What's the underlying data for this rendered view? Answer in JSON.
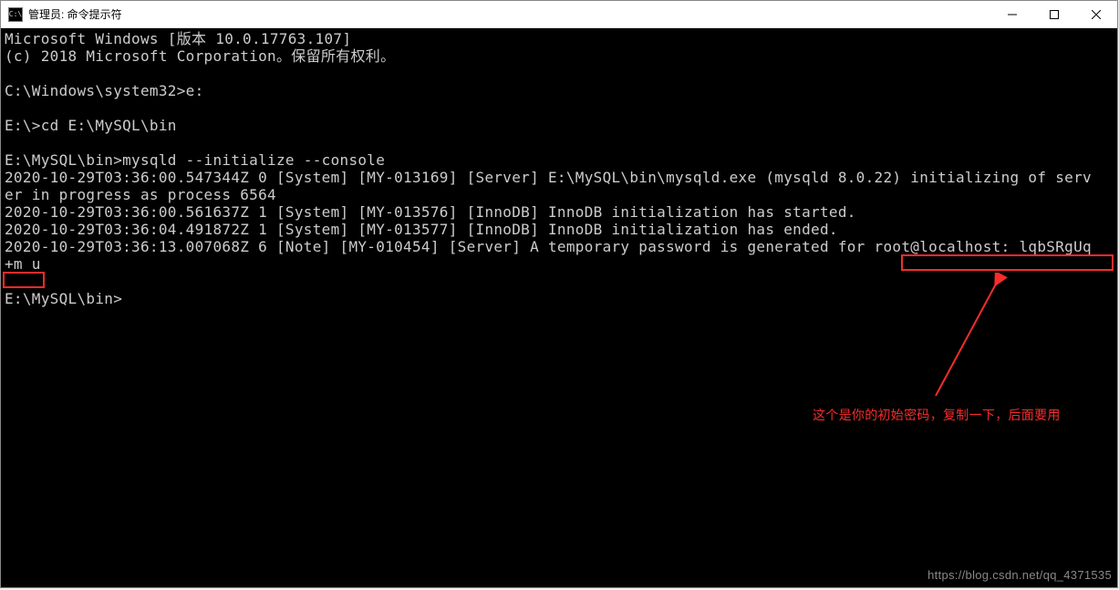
{
  "titlebar": {
    "icon_text": "C:\\",
    "title": "管理员: 命令提示符"
  },
  "terminal": {
    "line1": "Microsoft Windows [版本 10.0.17763.107]",
    "line2": "(c) 2018 Microsoft Corporation。保留所有权利。",
    "blank1": "",
    "line3": "C:\\Windows\\system32>e:",
    "blank2": "",
    "line4": "E:\\>cd E:\\MySQL\\bin",
    "blank3": "",
    "line5": "E:\\MySQL\\bin>mysqld --initialize --console",
    "line6": "2020-10-29T03:36:00.547344Z 0 [System] [MY-013169] [Server] E:\\MySQL\\bin\\mysqld.exe (mysqld 8.0.22) initializing of serv",
    "line7": "er in progress as process 6564",
    "line8": "2020-10-29T03:36:00.561637Z 1 [System] [MY-013576] [InnoDB] InnoDB initialization has started.",
    "line9": "2020-10-29T03:36:04.491872Z 1 [System] [MY-013577] [InnoDB] InnoDB initialization has ended.",
    "line10": "2020-10-29T03:36:13.007068Z 6 [Note] [MY-010454] [Server] A temporary password is generated for root@localhost: lqbSRgUq",
    "line11": "+m_u",
    "blank4": "",
    "line12": "E:\\MySQL\\bin>"
  },
  "annotation": {
    "text": "这个是你的初始密码，复制一下，后面要用"
  },
  "watermark": {
    "text": "https://blog.csdn.net/qq_4371535"
  },
  "highlight": {
    "password_part1": "root@localhost: lqbSRgUq",
    "password_part2": "+m_u"
  }
}
